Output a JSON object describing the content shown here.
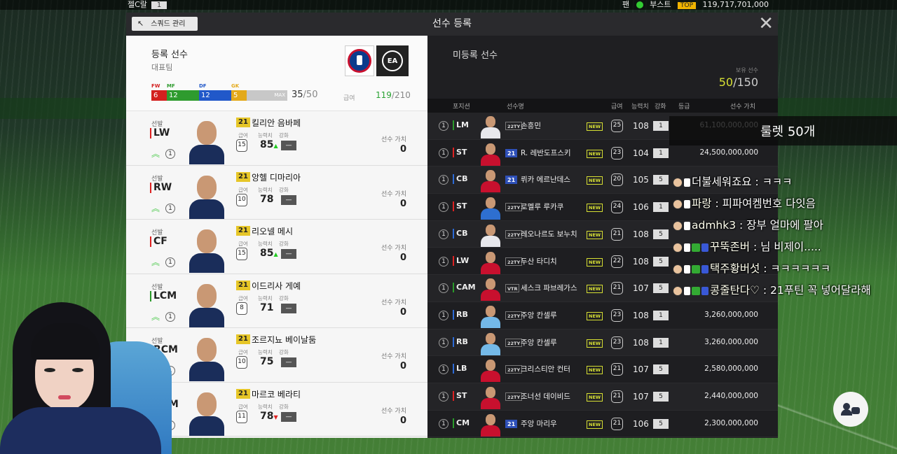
{
  "topbar": {
    "nick": "젤C랄",
    "level": "1",
    "fan_label": "팬",
    "boost_label": "부스트",
    "top_badge": "TOP",
    "bp": "119,717,701,000"
  },
  "header": {
    "title": "선수 등록",
    "squad_btn": "스쿼드 관리",
    "close": "✕"
  },
  "left": {
    "title": "등록 선수",
    "subtitle": "대표팀",
    "pos_labels": [
      "FW",
      "MF",
      "DF",
      "GK"
    ],
    "pos_counts": [
      "6",
      "12",
      "12",
      "5"
    ],
    "pos_colors": [
      "#d3201f",
      "#2e9b2e",
      "#2158c9",
      "#e3a91a"
    ],
    "max_label": "MAX",
    "count_cur": "35",
    "count_max": "/50",
    "salary_label": "급여",
    "salary_cur": "119",
    "salary_max": "/210",
    "col_salary": "급여",
    "col_ovr": "능력치",
    "col_enh": "강화",
    "val_label": "선수 가치",
    "start_label": "선발",
    "players": [
      {
        "pos": "LW",
        "season": "21",
        "name": "킬리안 음바페",
        "salary": "15",
        "ovr": "85",
        "arrow": "up",
        "enh": "—",
        "value": "0",
        "circle": "1"
      },
      {
        "pos": "RW",
        "season": "21",
        "name": "앙헬 디마리아",
        "salary": "10",
        "ovr": "78",
        "arrow": "",
        "enh": "—",
        "value": "0",
        "circle": "1"
      },
      {
        "pos": "CF",
        "season": "21",
        "name": "리오넬 메시",
        "salary": "15",
        "ovr": "85",
        "arrow": "up",
        "enh": "—",
        "value": "0",
        "circle": "1"
      },
      {
        "pos": "LCM",
        "season": "21",
        "name": "이드리사 게예",
        "salary": "8",
        "ovr": "71",
        "arrow": "",
        "enh": "—",
        "value": "0",
        "circle": "1"
      },
      {
        "pos": "RCM",
        "season": "21",
        "name": "조르지뇨 베이날둠",
        "salary": "10",
        "ovr": "75",
        "arrow": "",
        "enh": "—",
        "value": "0",
        "circle": "1"
      },
      {
        "pos": "CDM",
        "season": "21",
        "name": "마르코 베라티",
        "salary": "11",
        "ovr": "78",
        "arrow": "down",
        "enh": "—",
        "value": "0",
        "circle": "1"
      }
    ]
  },
  "right": {
    "title": "미등록 선수",
    "own_label": "보유 선수",
    "own_cur": "50",
    "own_max": "/150",
    "cols": [
      "포지션",
      "선수명",
      "급여",
      "능력치",
      "강화",
      "등급",
      "선수 가치"
    ],
    "new_label": "NEW",
    "players": [
      {
        "pos": "LM",
        "season": "22TY",
        "name": "손흥민",
        "salary": "25",
        "ovr": "108",
        "enh": "1",
        "value": "61,100,000,000"
      },
      {
        "pos": "ST",
        "season": "21",
        "name": "R. 레반도프스키",
        "salary": "23",
        "ovr": "104",
        "enh": "1",
        "value": "24,500,000,000"
      },
      {
        "pos": "CB",
        "season": "21",
        "name": "뤼카 에르난데스",
        "salary": "20",
        "ovr": "105",
        "enh": "5",
        "value": ""
      },
      {
        "pos": "ST",
        "season": "22TY",
        "name": "로멜루 루카쿠",
        "salary": "24",
        "ovr": "106",
        "enh": "1",
        "value": ""
      },
      {
        "pos": "CB",
        "season": "22TY",
        "name": "레오나르도 보누치",
        "salary": "21",
        "ovr": "108",
        "enh": "5",
        "value": ""
      },
      {
        "pos": "LW",
        "season": "22TY",
        "name": "두산 타디치",
        "salary": "22",
        "ovr": "108",
        "enh": "5",
        "value": ""
      },
      {
        "pos": "CAM",
        "season": "VTR",
        "name": "세스크 파브레가스",
        "salary": "21",
        "ovr": "107",
        "enh": "5",
        "value": ""
      },
      {
        "pos": "RB",
        "season": "22TY",
        "name": "주앙 칸셀루",
        "salary": "23",
        "ovr": "108",
        "enh": "1",
        "value": "3,260,000,000"
      },
      {
        "pos": "RB",
        "season": "22TY",
        "name": "주앙 칸셀루",
        "salary": "23",
        "ovr": "108",
        "enh": "1",
        "value": "3,260,000,000"
      },
      {
        "pos": "LB",
        "season": "22TY",
        "name": "크리스티안 컨터",
        "salary": "21",
        "ovr": "107",
        "enh": "5",
        "value": "2,580,000,000"
      },
      {
        "pos": "ST",
        "season": "22TY",
        "name": "조너선 데이비드",
        "salary": "21",
        "ovr": "107",
        "enh": "5",
        "value": "2,440,000,000"
      },
      {
        "pos": "CM",
        "season": "21",
        "name": "주앙 마리우",
        "salary": "21",
        "ovr": "106",
        "enh": "5",
        "value": "2,300,000,000"
      }
    ]
  },
  "chat": {
    "banner": "룰렛 50개",
    "lines": [
      {
        "nick": "",
        "msg": "더불세워죠요 : ㅋㅋㅋ"
      },
      {
        "nick": "파랑",
        "msg": " : 피파여켐번호 다잇음"
      },
      {
        "nick": "admhk3",
        "msg": " : 장부 얼마에 팔아"
      },
      {
        "nick": "꾸뚝존버",
        "msg": " : 님 비제이....."
      },
      {
        "nick": "택주황버섯",
        "msg": " : ㅋㅋㅋㅋㅋㅋ"
      },
      {
        "nick": "콩줄탄다♡",
        "msg": " : 21푸틴 꼭 넣어달라해"
      }
    ]
  }
}
